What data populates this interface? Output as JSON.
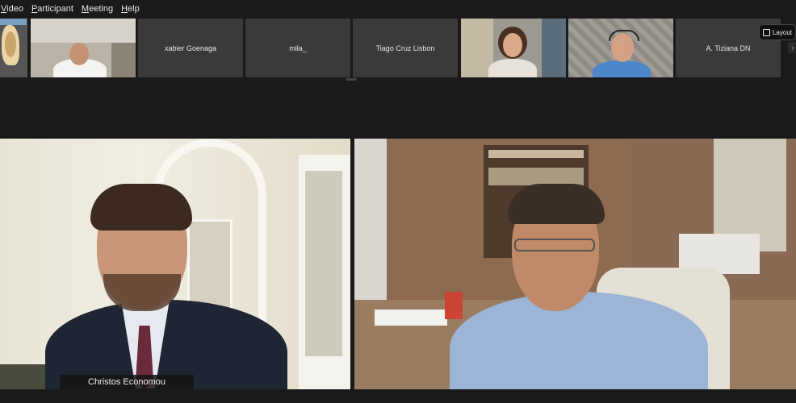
{
  "menu": {
    "items": [
      "Video",
      "Participant",
      "Meeting",
      "Help"
    ]
  },
  "participants": [
    {
      "name": "",
      "has_video": true
    },
    {
      "name": "",
      "has_video": true
    },
    {
      "name": "xabier Goenaga",
      "has_video": false
    },
    {
      "name": "mila_",
      "has_video": false
    },
    {
      "name": "Tiago Cruz Lisbon",
      "has_video": false
    },
    {
      "name": "",
      "has_video": true
    },
    {
      "name": "",
      "has_video": true
    },
    {
      "name": "A. Tiziana DN",
      "has_video": false
    }
  ],
  "layout_button": {
    "label": "Layout"
  },
  "main": {
    "speaker_name": "Christos Economou"
  }
}
